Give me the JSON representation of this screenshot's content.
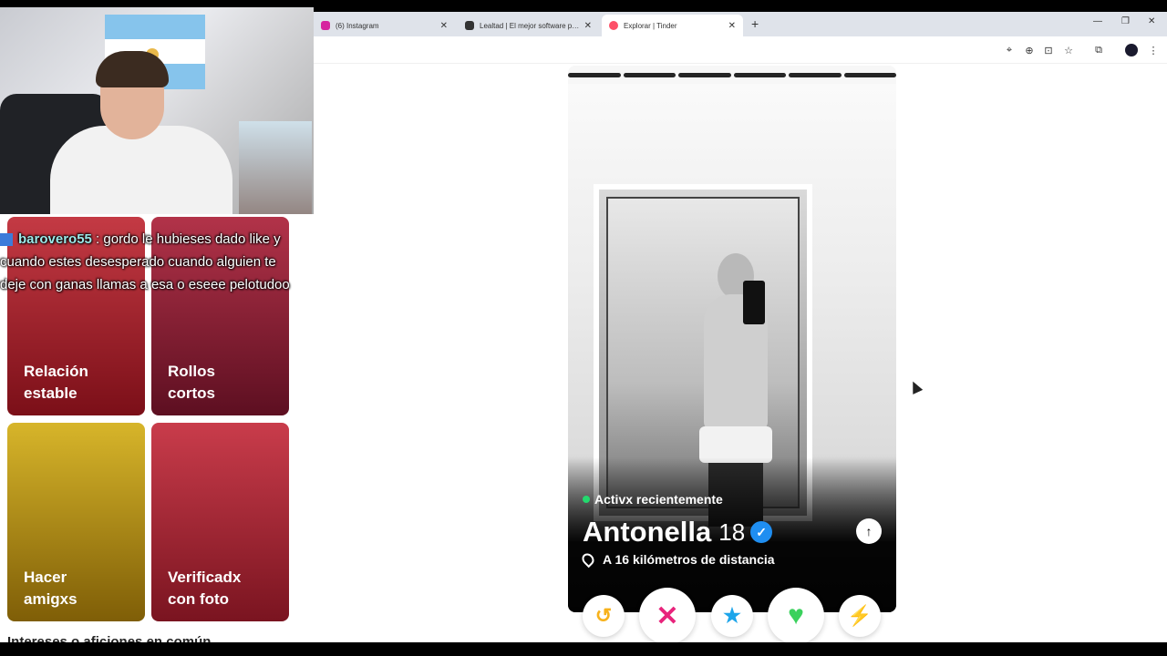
{
  "browser": {
    "tabs": [
      {
        "label": "(6) Instagram",
        "favicon_color": "#d6249f",
        "active": false
      },
      {
        "label": "Lealtad | El mejor software para",
        "favicon_color": "#333333",
        "active": false
      },
      {
        "label": "Explorar | Tinder",
        "favicon_color": "#fd5068",
        "active": true
      }
    ],
    "new_tab_label": "+",
    "window_controls": {
      "minimize": "—",
      "restore": "❐",
      "close": "✕"
    },
    "toolbar_icons": [
      "location-pin-icon",
      "zoom-icon",
      "install-icon",
      "bookmark-star-icon",
      "extensions-icon",
      "profile-icon",
      "menu-icon"
    ]
  },
  "interests": {
    "cards": [
      {
        "label": "Relación estable",
        "color": "#b0202c"
      },
      {
        "label": "Rollos cortos",
        "color": "#9a1f37"
      },
      {
        "label": "Hacer amigxs",
        "color": "#c9a114"
      },
      {
        "label": "Verificadx con foto",
        "color": "#b8283a"
      }
    ],
    "section_heading": "Intereses o aficiones en común"
  },
  "chat": {
    "username": "barovero55",
    "message": ": gordo le hubieses dado like y cuando estes desesperado cuando alguien te deje con ganas llamas a esa o eseee pelotudoo"
  },
  "profile": {
    "status": "Activx recientemente",
    "name": "Antonella",
    "age": "18",
    "distance": "A 16 kilómetros de distancia",
    "photo_count": 6
  },
  "actions": [
    {
      "name": "rewind-icon",
      "symbol": "↺",
      "color": "#f7b21c"
    },
    {
      "name": "nope-icon",
      "symbol": "✕",
      "color": "#e8247c"
    },
    {
      "name": "super-like-icon",
      "symbol": "★",
      "color": "#1da5ea"
    },
    {
      "name": "like-icon",
      "symbol": "♥",
      "color": "#3ad15c"
    },
    {
      "name": "boost-icon",
      "symbol": "⚡",
      "color": "#b42ae8"
    }
  ]
}
